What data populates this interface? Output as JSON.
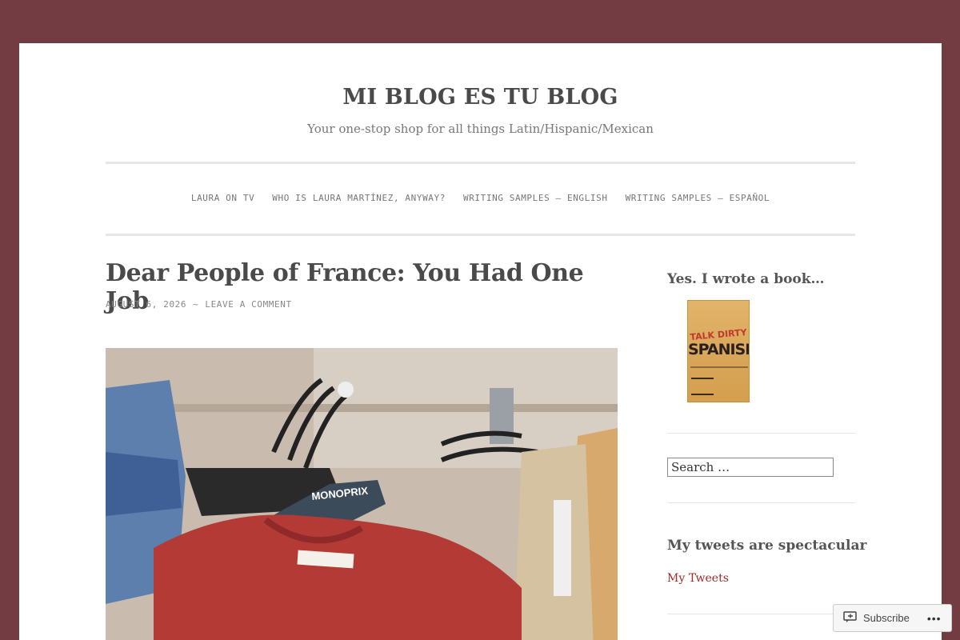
{
  "site": {
    "title": "MI BLOG ES TU BLOG",
    "description": "Your one-stop shop for all things Latin/Hispanic/Mexican"
  },
  "nav": {
    "items": [
      {
        "label": "LAURA ON TV"
      },
      {
        "label": "WHO IS LAURA MARTÍNEZ, ANYWAY?"
      },
      {
        "label": "WRITING SAMPLES – ENGLISH"
      },
      {
        "label": "WRITING SAMPLES – ESPAÑOL"
      }
    ]
  },
  "post": {
    "title": "Dear People of France: You Had One Job",
    "date": "AUGUST 6, 2026",
    "separator": "~",
    "comment_link": "LEAVE A COMMENT",
    "image_hanger_text": "MONOPRIX"
  },
  "sidebar": {
    "book_widget_title": "Yes. I wrote a book…",
    "book_cover_line1": "TALK DIRTY",
    "book_cover_line2": "SPANISH",
    "search_placeholder": "Search …",
    "tweets_widget_title": "My tweets are spectacular",
    "tweets_link": "My Tweets"
  },
  "subscribe": {
    "label": "Subscribe",
    "more": "•••",
    "icon": "follow-icon"
  },
  "colors": {
    "background": "#733c42",
    "link_accent": "#a12a2a"
  }
}
